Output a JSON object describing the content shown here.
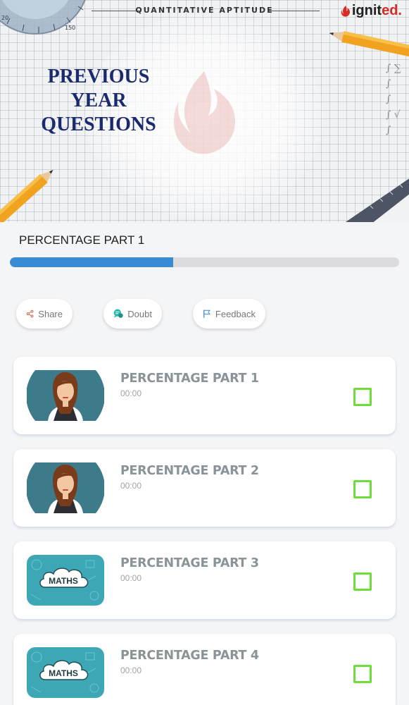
{
  "banner": {
    "subject_label": "QUANTITATIVE APTITUDE",
    "brand_name": "ignit",
    "brand_suffix": "ed.",
    "title_lines": [
      "PREVIOUS",
      "YEAR",
      "QUESTIONS"
    ]
  },
  "course": {
    "title": "PERCENTAGE PART 1",
    "progress_percent": 42
  },
  "actions": {
    "share": "Share",
    "doubt": "Doubt",
    "feedback": "Feedback"
  },
  "lessons": [
    {
      "title": "PERCENTAGE PART 1",
      "duration": "00:00",
      "thumb": "teacher-avatar"
    },
    {
      "title": "PERCENTAGE PART 2",
      "duration": "00:00",
      "thumb": "teacher-avatar"
    },
    {
      "title": "PERCENTAGE PART 3",
      "duration": "00:00",
      "thumb": "maths-cloud"
    },
    {
      "title": "PERCENTAGE PART 4",
      "duration": "00:00",
      "thumb": "maths-cloud"
    }
  ],
  "thumb_text": {
    "maths": "MATHS"
  },
  "colors": {
    "accent_blue": "#3a8bd6",
    "check_green": "#6fdc3c",
    "title_navy": "#1a2a6c",
    "brand_red": "#d72b27"
  }
}
